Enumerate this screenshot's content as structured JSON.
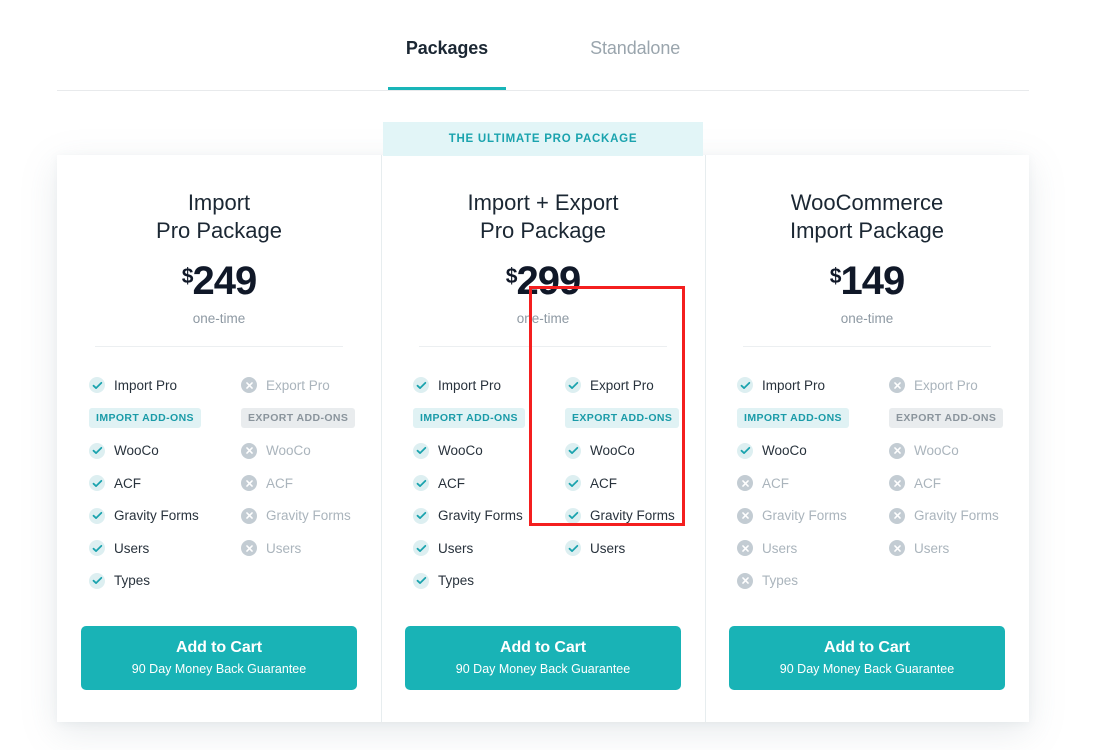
{
  "tabs": [
    {
      "label": "Packages",
      "active": true
    },
    {
      "label": "Standalone",
      "active": false
    }
  ],
  "ribbon": {
    "label": "THE ULTIMATE PRO PACKAGE"
  },
  "colors": {
    "accent_teal": "#19b3b6",
    "ribbon_bg": "#e2f5f7",
    "price_navy": "#101828",
    "muted_gray": "#aab4bc",
    "highlight_red": "#f41f1f"
  },
  "cta": {
    "label": "Add to Cart",
    "guarantee": "90 Day Money Back Guarantee"
  },
  "badges": {
    "import": "IMPORT ADD-ONS",
    "export": "EXPORT ADD-ONS"
  },
  "plans": [
    {
      "title_line1": "Import",
      "title_line2": "Pro Package",
      "currency": "$",
      "price": "249",
      "period": "one-time",
      "featured": false,
      "import": {
        "header": {
          "label": "Import Pro",
          "on": true
        },
        "items": [
          {
            "label": "WooCo",
            "on": true
          },
          {
            "label": "ACF",
            "on": true
          },
          {
            "label": "Gravity Forms",
            "on": true
          },
          {
            "label": "Users",
            "on": true
          },
          {
            "label": "Types",
            "on": true
          }
        ]
      },
      "export": {
        "header": {
          "label": "Export Pro",
          "on": false
        },
        "items": [
          {
            "label": "WooCo",
            "on": false
          },
          {
            "label": "ACF",
            "on": false
          },
          {
            "label": "Gravity Forms",
            "on": false
          },
          {
            "label": "Users",
            "on": false
          }
        ]
      }
    },
    {
      "title_line1": "Import + Export",
      "title_line2": "Pro Package",
      "currency": "$",
      "price": "299",
      "period": "one-time",
      "featured": true,
      "import": {
        "header": {
          "label": "Import Pro",
          "on": true
        },
        "items": [
          {
            "label": "WooCo",
            "on": true
          },
          {
            "label": "ACF",
            "on": true
          },
          {
            "label": "Gravity Forms",
            "on": true
          },
          {
            "label": "Users",
            "on": true
          },
          {
            "label": "Types",
            "on": true
          }
        ]
      },
      "export": {
        "header": {
          "label": "Export Pro",
          "on": true
        },
        "items": [
          {
            "label": "WooCo",
            "on": true
          },
          {
            "label": "ACF",
            "on": true
          },
          {
            "label": "Gravity Forms",
            "on": true
          },
          {
            "label": "Users",
            "on": true
          }
        ]
      }
    },
    {
      "title_line1": "WooCommerce",
      "title_line2": "Import Package",
      "currency": "$",
      "price": "149",
      "period": "one-time",
      "featured": false,
      "import": {
        "header": {
          "label": "Import Pro",
          "on": true
        },
        "items": [
          {
            "label": "WooCo",
            "on": true
          },
          {
            "label": "ACF",
            "on": false
          },
          {
            "label": "Gravity Forms",
            "on": false
          },
          {
            "label": "Users",
            "on": false
          },
          {
            "label": "Types",
            "on": false
          }
        ]
      },
      "export": {
        "header": {
          "label": "Export Pro",
          "on": false
        },
        "items": [
          {
            "label": "WooCo",
            "on": false
          },
          {
            "label": "ACF",
            "on": false
          },
          {
            "label": "Gravity Forms",
            "on": false
          },
          {
            "label": "Users",
            "on": false
          }
        ]
      }
    }
  ],
  "annotation": {
    "target_plan_index": 1,
    "target_column": "export"
  }
}
